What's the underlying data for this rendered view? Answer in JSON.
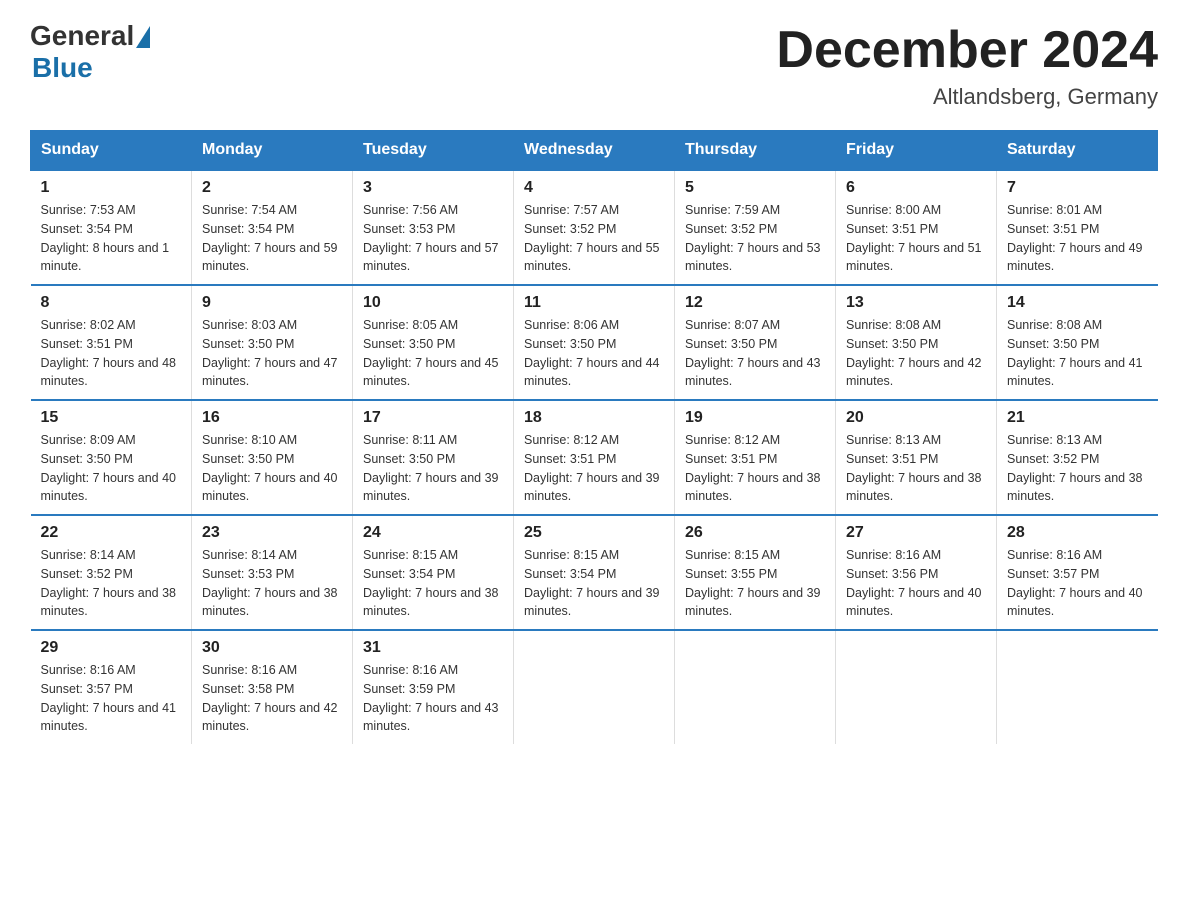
{
  "header": {
    "logo_general": "General",
    "logo_blue": "Blue",
    "month_title": "December 2024",
    "location": "Altlandsberg, Germany"
  },
  "weekdays": [
    "Sunday",
    "Monday",
    "Tuesday",
    "Wednesday",
    "Thursday",
    "Friday",
    "Saturday"
  ],
  "weeks": [
    [
      {
        "day": "1",
        "sunrise": "7:53 AM",
        "sunset": "3:54 PM",
        "daylight": "8 hours and 1 minute."
      },
      {
        "day": "2",
        "sunrise": "7:54 AM",
        "sunset": "3:54 PM",
        "daylight": "7 hours and 59 minutes."
      },
      {
        "day": "3",
        "sunrise": "7:56 AM",
        "sunset": "3:53 PM",
        "daylight": "7 hours and 57 minutes."
      },
      {
        "day": "4",
        "sunrise": "7:57 AM",
        "sunset": "3:52 PM",
        "daylight": "7 hours and 55 minutes."
      },
      {
        "day": "5",
        "sunrise": "7:59 AM",
        "sunset": "3:52 PM",
        "daylight": "7 hours and 53 minutes."
      },
      {
        "day": "6",
        "sunrise": "8:00 AM",
        "sunset": "3:51 PM",
        "daylight": "7 hours and 51 minutes."
      },
      {
        "day": "7",
        "sunrise": "8:01 AM",
        "sunset": "3:51 PM",
        "daylight": "7 hours and 49 minutes."
      }
    ],
    [
      {
        "day": "8",
        "sunrise": "8:02 AM",
        "sunset": "3:51 PM",
        "daylight": "7 hours and 48 minutes."
      },
      {
        "day": "9",
        "sunrise": "8:03 AM",
        "sunset": "3:50 PM",
        "daylight": "7 hours and 47 minutes."
      },
      {
        "day": "10",
        "sunrise": "8:05 AM",
        "sunset": "3:50 PM",
        "daylight": "7 hours and 45 minutes."
      },
      {
        "day": "11",
        "sunrise": "8:06 AM",
        "sunset": "3:50 PM",
        "daylight": "7 hours and 44 minutes."
      },
      {
        "day": "12",
        "sunrise": "8:07 AM",
        "sunset": "3:50 PM",
        "daylight": "7 hours and 43 minutes."
      },
      {
        "day": "13",
        "sunrise": "8:08 AM",
        "sunset": "3:50 PM",
        "daylight": "7 hours and 42 minutes."
      },
      {
        "day": "14",
        "sunrise": "8:08 AM",
        "sunset": "3:50 PM",
        "daylight": "7 hours and 41 minutes."
      }
    ],
    [
      {
        "day": "15",
        "sunrise": "8:09 AM",
        "sunset": "3:50 PM",
        "daylight": "7 hours and 40 minutes."
      },
      {
        "day": "16",
        "sunrise": "8:10 AM",
        "sunset": "3:50 PM",
        "daylight": "7 hours and 40 minutes."
      },
      {
        "day": "17",
        "sunrise": "8:11 AM",
        "sunset": "3:50 PM",
        "daylight": "7 hours and 39 minutes."
      },
      {
        "day": "18",
        "sunrise": "8:12 AM",
        "sunset": "3:51 PM",
        "daylight": "7 hours and 39 minutes."
      },
      {
        "day": "19",
        "sunrise": "8:12 AM",
        "sunset": "3:51 PM",
        "daylight": "7 hours and 38 minutes."
      },
      {
        "day": "20",
        "sunrise": "8:13 AM",
        "sunset": "3:51 PM",
        "daylight": "7 hours and 38 minutes."
      },
      {
        "day": "21",
        "sunrise": "8:13 AM",
        "sunset": "3:52 PM",
        "daylight": "7 hours and 38 minutes."
      }
    ],
    [
      {
        "day": "22",
        "sunrise": "8:14 AM",
        "sunset": "3:52 PM",
        "daylight": "7 hours and 38 minutes."
      },
      {
        "day": "23",
        "sunrise": "8:14 AM",
        "sunset": "3:53 PM",
        "daylight": "7 hours and 38 minutes."
      },
      {
        "day": "24",
        "sunrise": "8:15 AM",
        "sunset": "3:54 PM",
        "daylight": "7 hours and 38 minutes."
      },
      {
        "day": "25",
        "sunrise": "8:15 AM",
        "sunset": "3:54 PM",
        "daylight": "7 hours and 39 minutes."
      },
      {
        "day": "26",
        "sunrise": "8:15 AM",
        "sunset": "3:55 PM",
        "daylight": "7 hours and 39 minutes."
      },
      {
        "day": "27",
        "sunrise": "8:16 AM",
        "sunset": "3:56 PM",
        "daylight": "7 hours and 40 minutes."
      },
      {
        "day": "28",
        "sunrise": "8:16 AM",
        "sunset": "3:57 PM",
        "daylight": "7 hours and 40 minutes."
      }
    ],
    [
      {
        "day": "29",
        "sunrise": "8:16 AM",
        "sunset": "3:57 PM",
        "daylight": "7 hours and 41 minutes."
      },
      {
        "day": "30",
        "sunrise": "8:16 AM",
        "sunset": "3:58 PM",
        "daylight": "7 hours and 42 minutes."
      },
      {
        "day": "31",
        "sunrise": "8:16 AM",
        "sunset": "3:59 PM",
        "daylight": "7 hours and 43 minutes."
      },
      null,
      null,
      null,
      null
    ]
  ]
}
